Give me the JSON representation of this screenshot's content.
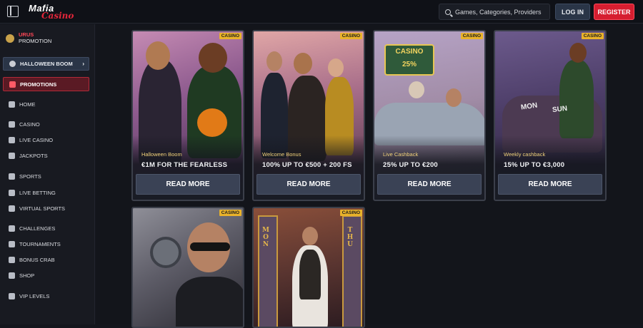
{
  "header": {
    "logo_top": "Mafia",
    "logo_bottom": "Casino",
    "search_placeholder": "Games, Categories, Providers",
    "login_label": "LOG IN",
    "register_label": "REGISTER"
  },
  "sidebar": {
    "user_name": "URUS",
    "user_sub": "PROMOTION",
    "halloween_label": "HALLOWEEN BOOM",
    "promotions_label": "PROMOTIONS",
    "items": [
      {
        "label": "HOME",
        "icon": "home-icon"
      },
      {
        "label": "CASINO",
        "icon": "casino-icon"
      },
      {
        "label": "LIVE CASINO",
        "icon": "live-casino-icon"
      },
      {
        "label": "JACKPOTS",
        "icon": "jackpots-icon"
      },
      {
        "label": "SPORTS",
        "icon": "sports-icon"
      },
      {
        "label": "LIVE BETTING",
        "icon": "live-betting-icon"
      },
      {
        "label": "VIRTUAL SPORTS",
        "icon": "virtual-sports-icon"
      },
      {
        "label": "CHALLENGES",
        "icon": "challenges-icon"
      },
      {
        "label": "TOURNAMENTS",
        "icon": "tournaments-icon"
      },
      {
        "label": "BONUS CRAB",
        "icon": "bonus-crab-icon"
      },
      {
        "label": "SHOP",
        "icon": "shop-icon"
      },
      {
        "label": "VIP LEVELS",
        "icon": "vip-levels-icon"
      }
    ]
  },
  "cards": [
    {
      "badge": "CASINO",
      "subtitle": "Halloween Boom",
      "headline": "€1M FOR THE FEARLESS",
      "button": "READ MORE"
    },
    {
      "badge": "CASINO",
      "subtitle": "Welcome Bonus",
      "headline": "100% UP TO €500 + 200 FS",
      "button": "READ MORE"
    },
    {
      "badge": "CASINO",
      "subtitle": "Live Cashback",
      "headline": "25% UP TO €200",
      "button": "READ MORE",
      "art_text_1": "CASINO",
      "art_text_2": "25%"
    },
    {
      "badge": "CASINO",
      "subtitle": "Weekly cashback",
      "headline": "15% UP TO €3,000",
      "button": "READ MORE",
      "art_text_1": "MON",
      "art_text_2": "SUN"
    },
    {
      "badge": "CASINO"
    },
    {
      "badge": "CASINO",
      "art_text_1": "MON",
      "art_text_2": "THU"
    }
  ],
  "colors": {
    "accent_red": "#d61e30",
    "badge_yellow": "#e9b22a",
    "button_bg": "#3a4255"
  }
}
